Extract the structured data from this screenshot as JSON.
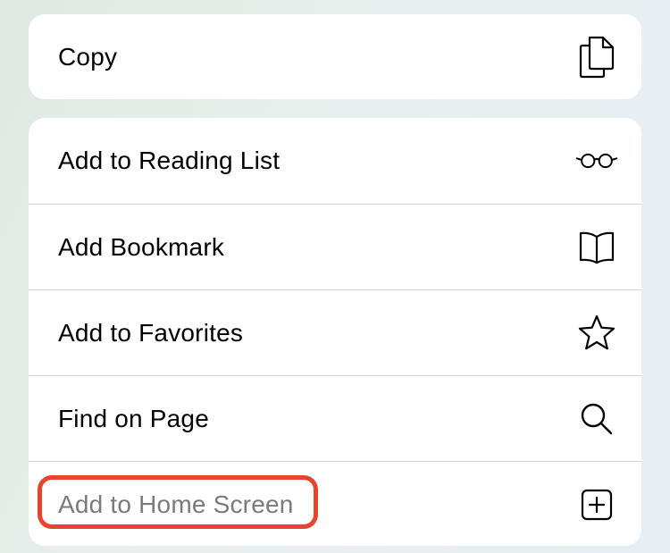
{
  "menu": {
    "copy": {
      "label": "Copy",
      "icon": "copy-icon"
    },
    "actions": [
      {
        "label": "Add to Reading List",
        "icon": "glasses-icon"
      },
      {
        "label": "Add Bookmark",
        "icon": "book-icon"
      },
      {
        "label": "Add to Favorites",
        "icon": "star-icon"
      },
      {
        "label": "Find on Page",
        "icon": "search-icon"
      },
      {
        "label": "Add to Home Screen",
        "icon": "plus-square-icon"
      }
    ]
  },
  "colors": {
    "highlight": "#e8432e",
    "dim_text": "#7a7a7e"
  }
}
